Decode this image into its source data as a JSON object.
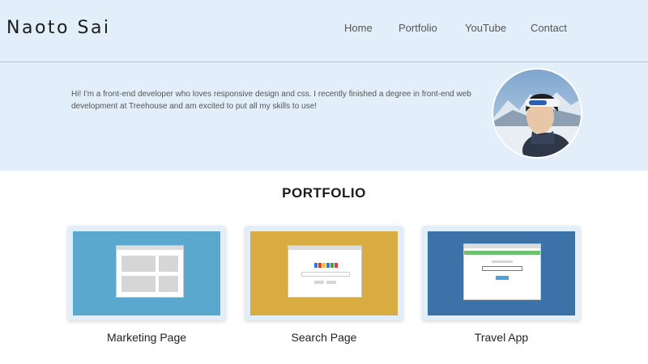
{
  "header": {
    "logo": "Naoto Sai",
    "nav": [
      "Home",
      "Portfolio",
      "YouTube",
      "Contact"
    ]
  },
  "intro": {
    "text": "Hi! I'm a front-end developer who loves responsive design and css. I recently finished a degree in front-end web development at Treehouse and am excited to put all my skills to use!"
  },
  "portfolio": {
    "title": "PORTFOLIO",
    "items": [
      {
        "label": "Marketing Page",
        "color": "#5ba8cf"
      },
      {
        "label": "Search Page",
        "color": "#d9ac41"
      },
      {
        "label": "Travel App",
        "color": "#3b73a9"
      }
    ]
  },
  "colors": {
    "header_bg": "#e2eef9",
    "card_frame": "#e2eef9"
  },
  "icons": [
    "avatar-photo"
  ]
}
